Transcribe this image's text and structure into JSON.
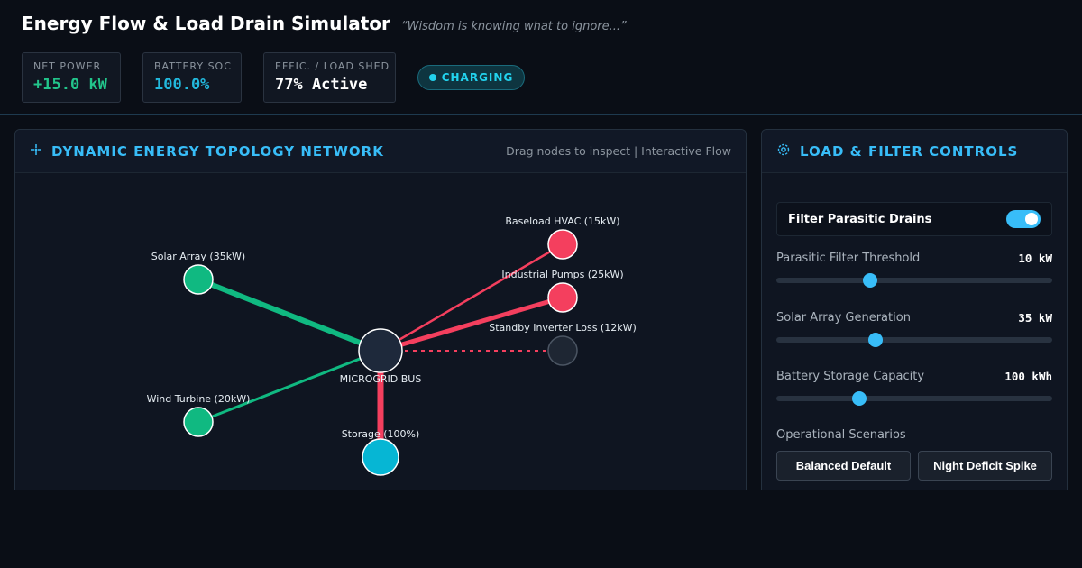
{
  "header": {
    "title": "Energy Flow & Load Drain Simulator",
    "tagline": "“Wisdom is knowing what to ignore...”"
  },
  "stats": [
    {
      "label": "NET POWER",
      "value": "+15.0 kW",
      "color": "#22c58b"
    },
    {
      "label": "BATTERY SOC",
      "value": "100.0%",
      "color": "#22b8dc"
    },
    {
      "label": "EFFIC. / LOAD SHED",
      "value": "77% Active",
      "color": "#ffffff"
    }
  ],
  "status_badge": "CHARGING",
  "topology": {
    "title": "DYNAMIC ENERGY TOPOLOGY NETWORK",
    "hint": "Drag nodes to inspect | Interactive Flow",
    "hub_label": "MICROGRID BUS",
    "nodes": {
      "solar": "Solar Array (35kW)",
      "wind": "Wind Turbine (20kW)",
      "hvac": "Baseload HVAC (15kW)",
      "pumps": "Industrial Pumps (25kW)",
      "inverter": "Standby Inverter Loss (12kW)",
      "storage": "Storage (100%)"
    },
    "colors": {
      "source": "#10b981",
      "load": "#f43f5e",
      "storage": "#06b6d4",
      "hub": "#1e293b",
      "idle": "#1e2633"
    }
  },
  "controls": {
    "title": "LOAD & FILTER CONTROLS",
    "toggle_label": "Filter Parasitic Drains",
    "toggle_on": true,
    "sliders": [
      {
        "name": "Parasitic Filter Threshold",
        "value": "10 kW",
        "fraction": 0.34
      },
      {
        "name": "Solar Array Generation",
        "value": "35 kW",
        "fraction": 0.36
      },
      {
        "name": "Battery Storage Capacity",
        "value": "100 kWh",
        "fraction": 0.3
      }
    ],
    "scenarios_title": "Operational Scenarios",
    "scenarios": [
      "Balanced Default",
      "Night Deficit Spike"
    ]
  }
}
